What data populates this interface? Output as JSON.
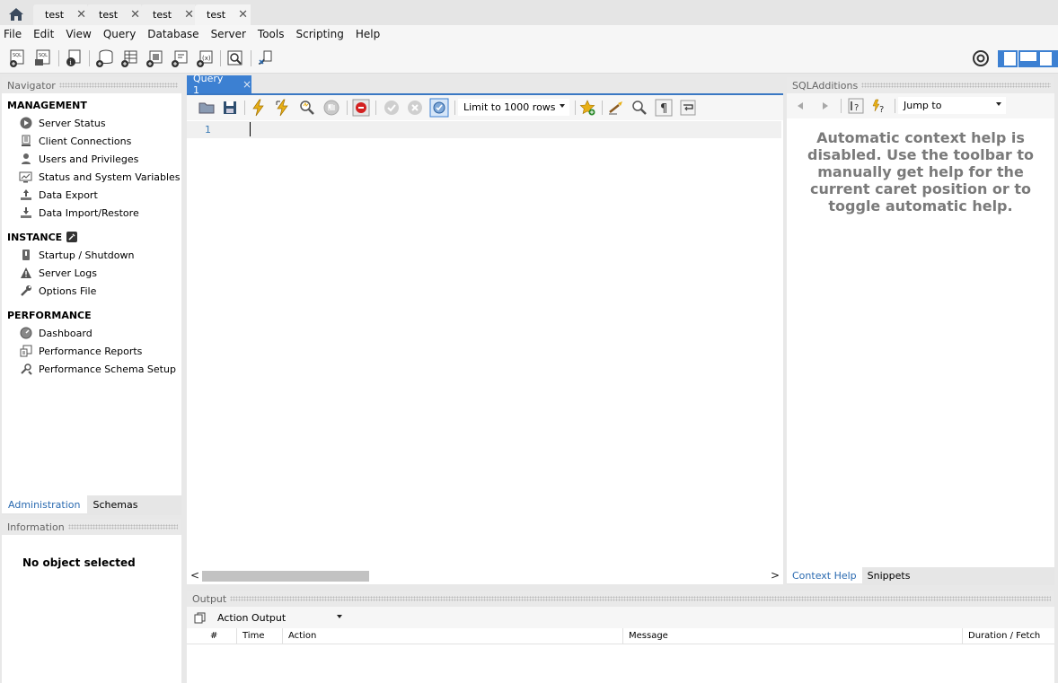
{
  "tabs": {
    "home_icon": "home-icon",
    "connections": [
      {
        "label": "test",
        "close": "✕"
      },
      {
        "label": "test",
        "close": "✕"
      },
      {
        "label": "test",
        "close": "✕"
      },
      {
        "label": "test",
        "close": "✕"
      }
    ]
  },
  "menu": [
    "File",
    "Edit",
    "View",
    "Query",
    "Database",
    "Server",
    "Tools",
    "Scripting",
    "Help"
  ],
  "navigator": {
    "title": "Navigator",
    "management": {
      "label": "MANAGEMENT",
      "items": [
        "Server Status",
        "Client Connections",
        "Users and Privileges",
        "Status and System Variables",
        "Data Export",
        "Data Import/Restore"
      ]
    },
    "instance": {
      "label": "INSTANCE",
      "items": [
        "Startup / Shutdown",
        "Server Logs",
        "Options File"
      ]
    },
    "performance": {
      "label": "PERFORMANCE",
      "items": [
        "Dashboard",
        "Performance Reports",
        "Performance Schema Setup"
      ]
    },
    "tabs": [
      "Administration",
      "Schemas"
    ]
  },
  "information": {
    "title": "Information",
    "message": "No object selected"
  },
  "query": {
    "tab_label": "Query 1",
    "tab_close": "×",
    "limit_select": "Limit to 1000 rows",
    "line_number": "1",
    "scroll_left": "<",
    "scroll_right": ">"
  },
  "sql_additions": {
    "title": "SQLAdditions",
    "jump_to": "Jump to",
    "help_text": "Automatic context help is disabled. Use the toolbar to manually get help for the current caret position or to toggle automatic help.",
    "tabs": [
      "Context Help",
      "Snippets"
    ]
  },
  "output": {
    "title": "Output",
    "select": "Action Output",
    "columns": [
      "#",
      "Time",
      "Action",
      "Message",
      "Duration / Fetch"
    ]
  },
  "colors": {
    "accent": "#3c80d2",
    "link": "#2a6ab0",
    "help_text": "#7a7a7a"
  }
}
